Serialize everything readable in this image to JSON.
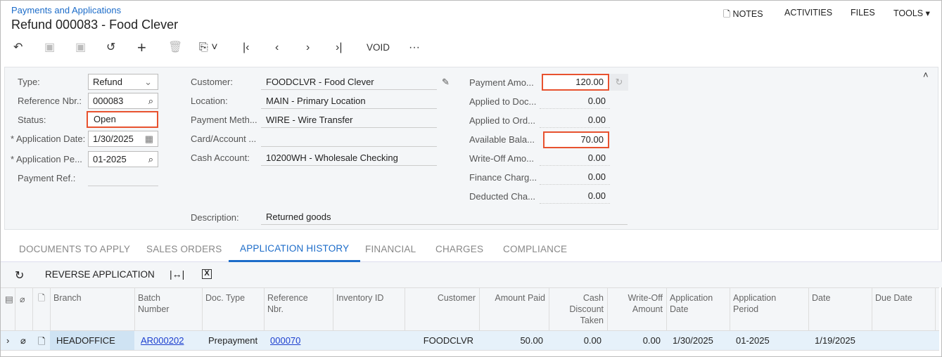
{
  "header": {
    "breadcrumb": "Payments and Applications",
    "title": "Refund 000083 - Food Clever",
    "notes": "NOTES",
    "activities": "ACTIVITIES",
    "files": "FILES",
    "tools": "TOOLS"
  },
  "toolbar": {
    "void": "VOID",
    "more": "···"
  },
  "form": {
    "type_label": "Type:",
    "type": "Refund",
    "ref_label": "Reference Nbr.:",
    "ref": "000083",
    "status_label": "Status:",
    "status": "Open",
    "appdate_label": "Application Date:",
    "appdate": "1/30/2025",
    "appperiod_label": "Application Pe...",
    "appperiod": "01-2025",
    "payref_label": "Payment Ref.:",
    "customer_label": "Customer:",
    "customer": "FOODCLVR - Food Clever",
    "location_label": "Location:",
    "location": "MAIN - Primary Location",
    "paymeth_label": "Payment Meth...",
    "paymeth": "WIRE - Wire Transfer",
    "card_label": "Card/Account ...",
    "cash_label": "Cash Account:",
    "cash": "10200WH - Wholesale Checking",
    "desc_label": "Description:",
    "desc": "Returned goods",
    "amounts": [
      {
        "label": "Payment Amo...",
        "value": "120.00"
      },
      {
        "label": "Applied to Doc...",
        "value": "0.00"
      },
      {
        "label": "Applied to Ord...",
        "value": "0.00"
      },
      {
        "label": "Available Bala...",
        "value": "70.00"
      },
      {
        "label": "Write-Off Amo...",
        "value": "0.00"
      },
      {
        "label": "Finance Charg...",
        "value": "0.00"
      },
      {
        "label": "Deducted Cha...",
        "value": "0.00"
      }
    ]
  },
  "tabs": [
    "DOCUMENTS TO APPLY",
    "SALES ORDERS",
    "APPLICATION HISTORY",
    "FINANCIAL",
    "CHARGES",
    "COMPLIANCE"
  ],
  "grid": {
    "reverse": "REVERSE APPLICATION",
    "columns": [
      "Branch",
      "Batch\nNumber",
      "Doc. Type",
      "Reference\nNbr.",
      "Inventory ID",
      "Customer",
      "Amount Paid",
      "Cash\nDiscount\nTaken",
      "Write-Off\nAmount",
      "Application\nDate",
      "Application\nPeriod",
      "Date",
      "Due Date"
    ],
    "rows": [
      [
        "HEADOFFICE",
        "AR000202",
        "Prepayment",
        "000070",
        "",
        "FOODCLVR",
        "50.00",
        "0.00",
        "0.00",
        "1/30/2025",
        "01-2025",
        "1/19/2025",
        ""
      ]
    ]
  }
}
